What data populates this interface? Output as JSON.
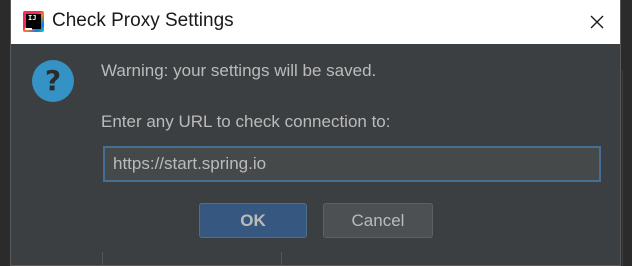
{
  "dialog": {
    "title": "Check Proxy Settings",
    "app_icon": "intellij-idea-icon",
    "icon_label": "IJ",
    "close_icon": "close-icon",
    "help_icon": "question-icon",
    "warning_text": "Warning: your settings will be saved.",
    "prompt_text": "Enter any URL to check connection to:",
    "url_value": "https://start.spring.io",
    "ok_label": "OK",
    "cancel_label": "Cancel"
  },
  "colors": {
    "background": "#3c3f41",
    "titlebar": "#ffffff",
    "text": "#bbbbbb",
    "accent": "#365880",
    "help_icon": "#3592c4",
    "input_border": "#466d94"
  }
}
